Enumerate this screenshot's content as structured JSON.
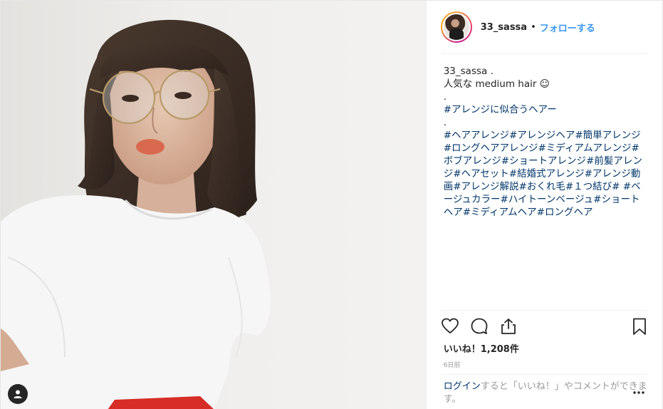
{
  "post": {
    "username": "33_sassa",
    "separator": "•",
    "follow_label": "フォローする",
    "caption": {
      "user": "33_sassa",
      "user_suffix": " .",
      "line1": "人気な medium hair ☺︎",
      "dot1": ".",
      "featured_tag": "#アレンジに似合うヘアー",
      "dot2": ".",
      "hashtags": "#ヘアアレンジ#アレンジヘア#簡単アレンジ#ロングヘアアレンジ#ミディアムアレンジ#ボブアレンジ#ショートアレンジ#前髪アレンジ#ヘアセット#結婚式アレンジ#アレンジ動画#アレンジ解説#おくれ毛#１つ結び# #ベージュカラー#ハイトーンベージュ#ショートヘア#ミディアムヘア#ロングヘア"
    },
    "likes_label": "いいね！1,208件",
    "time_ago": "6日前",
    "login": {
      "link": "ログイン",
      "text": "すると「いいね！」やコメントができます。"
    }
  },
  "icons": {
    "like": "heart-icon",
    "comment": "comment-icon",
    "share": "share-icon",
    "save": "bookmark-icon",
    "more": "more-options-icon",
    "user_tag": "user-tag-icon"
  },
  "colors": {
    "link_blue": "#3897f0",
    "hashtag": "#003569",
    "text": "#262626",
    "muted": "#999999"
  }
}
